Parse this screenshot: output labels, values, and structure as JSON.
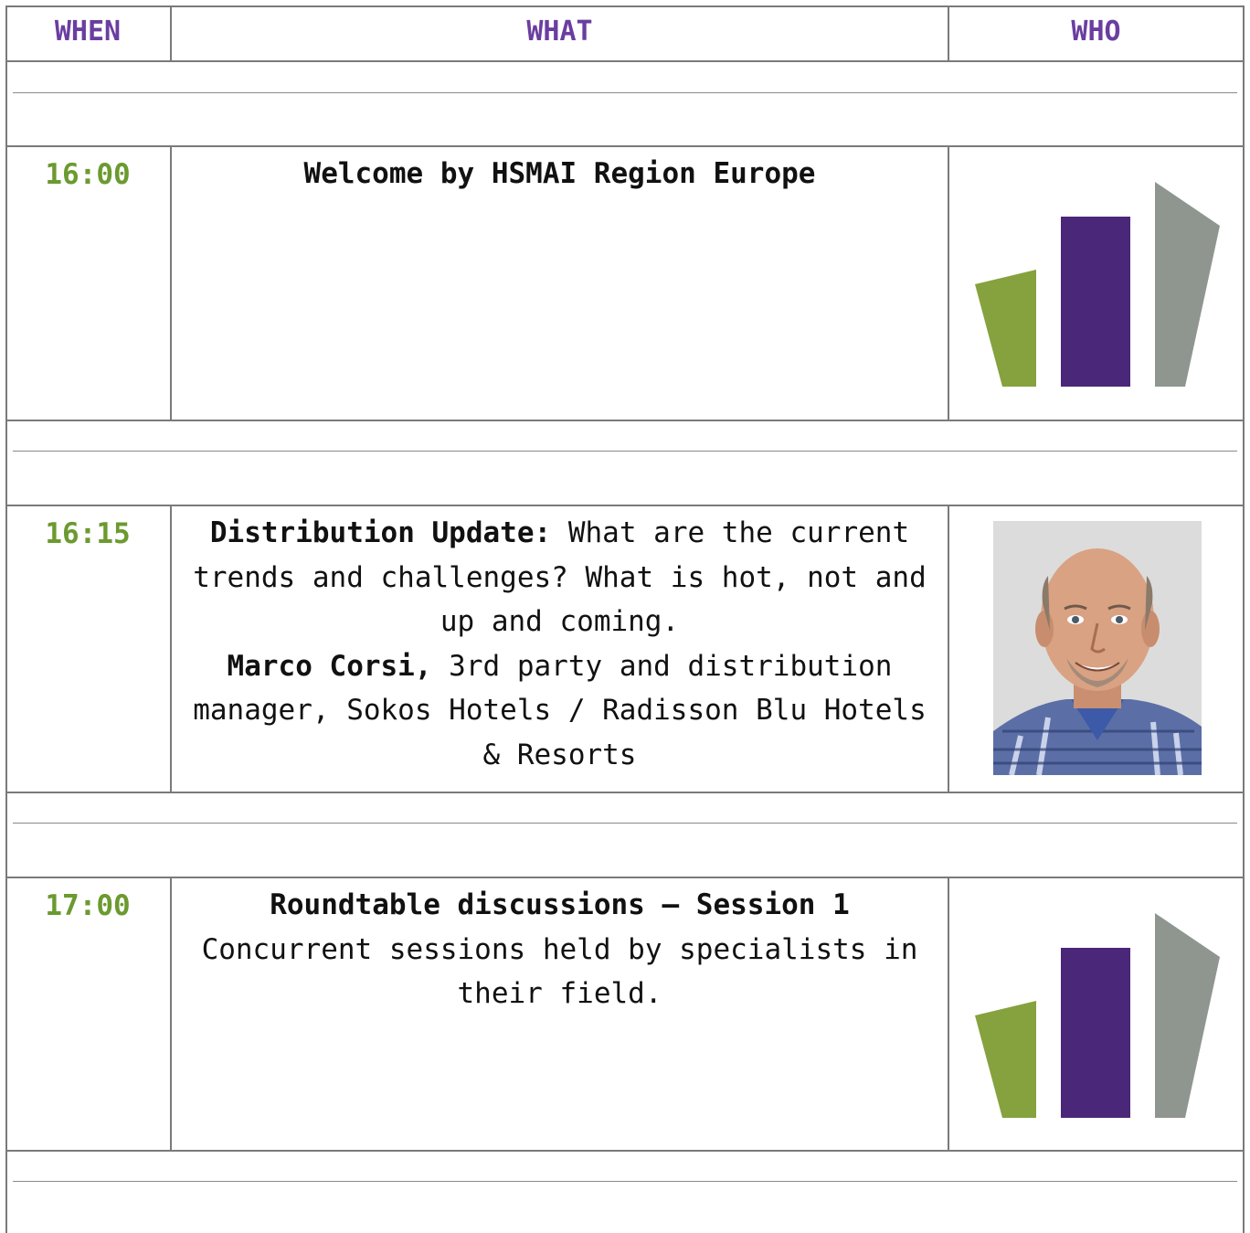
{
  "header": {
    "when": "WHEN",
    "what": "WHAT",
    "who": "WHO"
  },
  "colors": {
    "header_purple": "#6a3ea0",
    "time_green": "#6b9a2f",
    "logo_green": "#85a23e",
    "logo_purple": "#4a2778",
    "logo_gray": "#8f968f"
  },
  "sessions": [
    {
      "time": "16:00",
      "title": "Welcome by HSMAI Region Europe",
      "who": "hsmai-logo"
    },
    {
      "time": "16:15",
      "title": "Distribution Update:",
      "description": " What are the current trends and challenges? What is hot, not and up and coming.",
      "speaker_name": "Marco Corsi,",
      "speaker_role": " 3rd party and distribution manager, Sokos Hotels / Radisson Blu Hotels & Resorts",
      "who": "speaker-photo"
    },
    {
      "time": "17:00",
      "title": "Roundtable discussions – Session 1",
      "description": "Concurrent sessions held by specialists in their field.",
      "who": "hsmai-logo"
    }
  ]
}
